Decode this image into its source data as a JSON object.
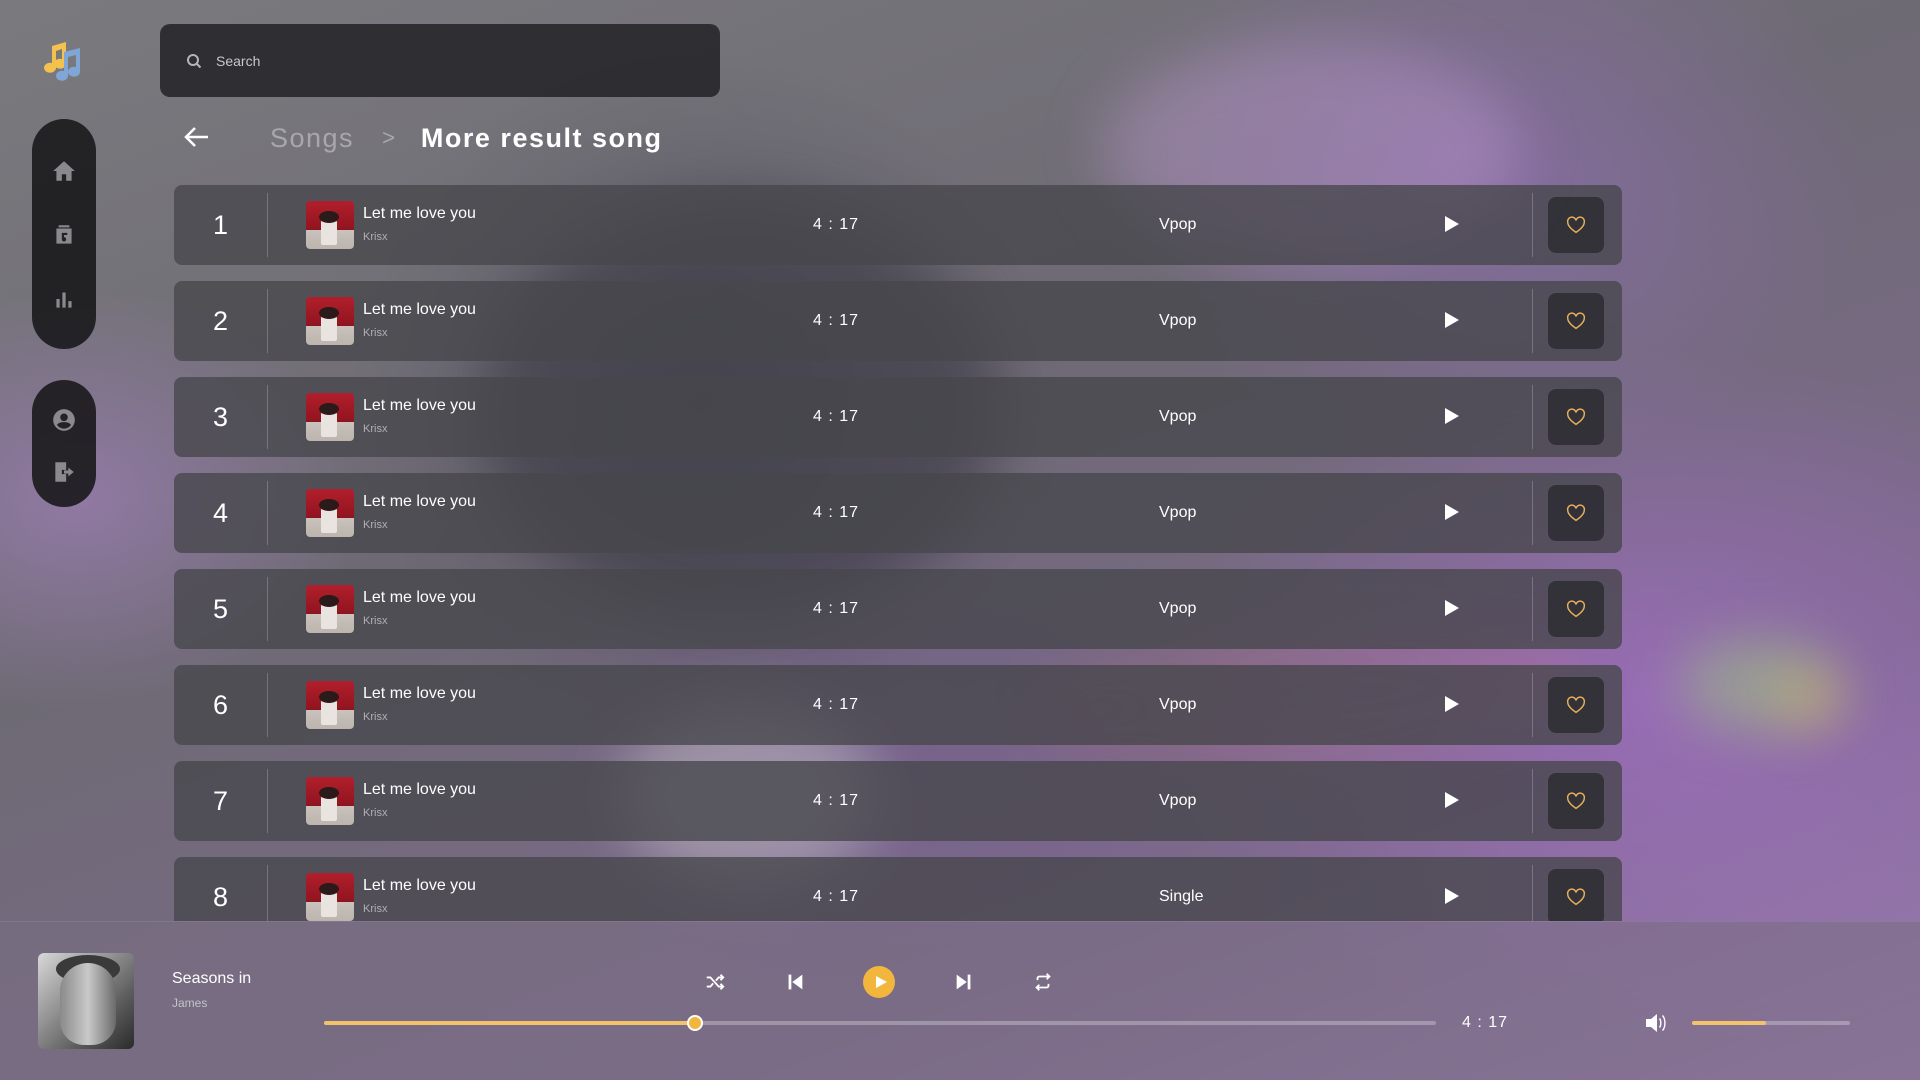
{
  "search": {
    "placeholder": "Search"
  },
  "breadcrumb": {
    "parent": "Songs",
    "separator": ">",
    "current": "More result song"
  },
  "sidebar": {
    "main_items": [
      {
        "icon": "home-icon"
      },
      {
        "icon": "library-icon"
      },
      {
        "icon": "chart-icon"
      }
    ],
    "account_items": [
      {
        "icon": "account-icon"
      },
      {
        "icon": "logout-icon"
      }
    ]
  },
  "songs": [
    {
      "num": "1",
      "title": "Let me love you",
      "artist": "Krisx",
      "duration": "4 : 17",
      "genre": "Vpop"
    },
    {
      "num": "2",
      "title": "Let me love you",
      "artist": "Krisx",
      "duration": "4 : 17",
      "genre": "Vpop"
    },
    {
      "num": "3",
      "title": "Let me love you",
      "artist": "Krisx",
      "duration": "4 : 17",
      "genre": "Vpop"
    },
    {
      "num": "4",
      "title": "Let me love you",
      "artist": "Krisx",
      "duration": "4 : 17",
      "genre": "Vpop"
    },
    {
      "num": "5",
      "title": "Let me love you",
      "artist": "Krisx",
      "duration": "4 : 17",
      "genre": "Vpop"
    },
    {
      "num": "6",
      "title": "Let me love you",
      "artist": "Krisx",
      "duration": "4 : 17",
      "genre": "Vpop"
    },
    {
      "num": "7",
      "title": "Let me love you",
      "artist": "Krisx",
      "duration": "4 : 17",
      "genre": "Vpop"
    },
    {
      "num": "8",
      "title": "Let me love you",
      "artist": "Krisx",
      "duration": "4 : 17",
      "genre": "Single"
    }
  ],
  "player": {
    "title": "Seasons in",
    "artist": "James",
    "duration": "4 : 17",
    "progress": 0.334,
    "volume": 0.47,
    "colors": {
      "accent": "#f3b63c",
      "progress": "#f3c26a"
    }
  }
}
